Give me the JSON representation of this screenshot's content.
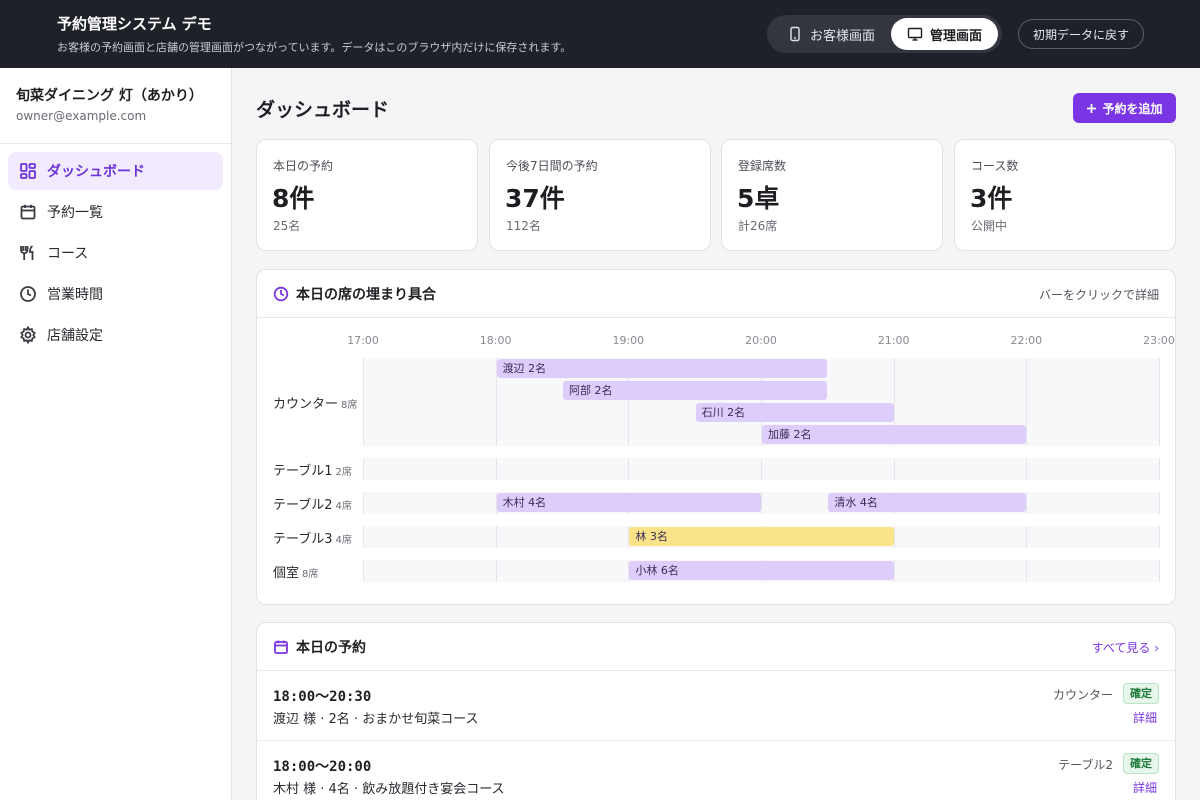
{
  "app": {
    "title": "予約管理システム デモ",
    "subtitle": "お客様の予約画面と店舗の管理画面がつながっています。データはこのブラウザ内だけに保存されます。",
    "modes": [
      {
        "label": "お客様画面",
        "icon": "phone-icon",
        "active": false
      },
      {
        "label": "管理画面",
        "icon": "monitor-icon",
        "active": true
      }
    ],
    "reset_label": "初期データに戻す"
  },
  "sidebar": {
    "store_name": "旬菜ダイニング 灯（あかり）",
    "store_email": "owner@example.com",
    "items": [
      {
        "label": "ダッシュボード",
        "icon": "dashboard-icon",
        "active": true
      },
      {
        "label": "予約一覧",
        "icon": "calendar-icon",
        "active": false
      },
      {
        "label": "コース",
        "icon": "utensils-icon",
        "active": false
      },
      {
        "label": "営業時間",
        "icon": "clock-icon",
        "active": false
      },
      {
        "label": "店舗設定",
        "icon": "gear-icon",
        "active": false
      }
    ]
  },
  "main": {
    "title": "ダッシュボード",
    "add_label": "予約を追加",
    "stats": [
      {
        "label": "本日の予約",
        "value": "8件",
        "sub": "25名"
      },
      {
        "label": "今後7日間の予約",
        "value": "37件",
        "sub": "112名"
      },
      {
        "label": "登録席数",
        "value": "5卓",
        "sub": "計26席"
      },
      {
        "label": "コース数",
        "value": "3件",
        "sub": "公開中"
      }
    ]
  },
  "occupancy": {
    "title": "本日の席の埋まり具合",
    "hint": "バーをクリックで詳細",
    "ticks": [
      "17:00",
      "18:00",
      "19:00",
      "20:00",
      "21:00",
      "22:00",
      "23:00"
    ],
    "rows": [
      {
        "name": "カウンター",
        "seats": "8席",
        "bookings": [
          {
            "label": "渡辺 2名",
            "start": 18.0,
            "end": 20.5,
            "color": "#dccdfb"
          },
          {
            "label": "阿部 2名",
            "start": 18.5,
            "end": 20.5,
            "color": "#dccdfb"
          },
          {
            "label": "石川 2名",
            "start": 19.5,
            "end": 21.0,
            "color": "#dccdfb"
          },
          {
            "label": "加藤 2名",
            "start": 20.0,
            "end": 22.0,
            "color": "#dccdfb"
          }
        ]
      },
      {
        "name": "テーブル1",
        "seats": "2席",
        "bookings": []
      },
      {
        "name": "テーブル2",
        "seats": "4席",
        "bookings": [
          {
            "label": "木村 4名",
            "start": 18.0,
            "end": 20.0,
            "color": "#dccdfb"
          },
          {
            "label": "清水 4名",
            "start": 20.5,
            "end": 22.0,
            "color": "#dccdfb"
          }
        ]
      },
      {
        "name": "テーブル3",
        "seats": "4席",
        "bookings": [
          {
            "label": "林 3名",
            "start": 19.0,
            "end": 21.0,
            "color": "#fbe38a"
          }
        ]
      },
      {
        "name": "個室",
        "seats": "8席",
        "bookings": [
          {
            "label": "小林 6名",
            "start": 19.0,
            "end": 21.0,
            "color": "#dccdfb"
          }
        ]
      }
    ]
  },
  "today": {
    "title": "本日の予約",
    "see_all": "すべて見る",
    "items": [
      {
        "time": "18:00〜20:30",
        "desc": "渡辺 様 · 2名 · おまかせ旬菜コース",
        "seat": "カウンター",
        "status": "確定",
        "detail": "詳細"
      },
      {
        "time": "18:00〜20:00",
        "desc": "木村 様 · 4名 · 飲み放題付き宴会コース",
        "seat": "テーブル2",
        "status": "確定",
        "detail": "詳細"
      }
    ]
  }
}
